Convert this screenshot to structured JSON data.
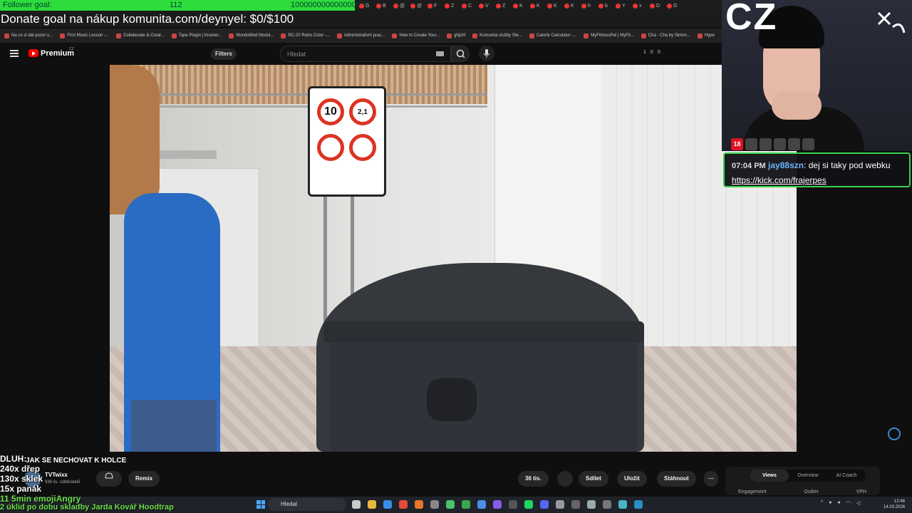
{
  "browser": {
    "follower_goal": {
      "label": "Follower goal:",
      "count": "112",
      "target": "100000000000000000",
      "progress": 0.0
    },
    "tabs": [
      "G",
      "B",
      "@",
      "@",
      "F",
      "Z",
      "C",
      "V",
      "Z",
      "K",
      "K",
      "K",
      "K",
      "h",
      "b",
      "Y",
      "x",
      "D",
      "G"
    ],
    "donate_text": "Donate goal na nákup komunita.com/deynyel: $0/$100",
    "bookmarks": [
      "Na co si dát pozor u...",
      "First Music Lesson -...",
      "Collaborate & Creat...",
      "Tape Plugin | Kramer...",
      "MondoMod Modul...",
      "RC-20 Retro Color -...",
      "Administrativní prac...",
      "How to Create Your...",
      "ghjshf",
      "Komunita služby Ste...",
      "Calorie Calculator -...",
      "MyFitnessPal | MyFit...",
      "Cha - Cha by Simon...",
      "Hype"
    ]
  },
  "youtube": {
    "logo_text": "Premium",
    "logo_region": "CZ",
    "filters_label": "Filters",
    "search_placeholder": "Hledat",
    "ext_counts": [
      "1",
      "0",
      "0"
    ]
  },
  "stream_overlay": {
    "cz_label": "CZ",
    "badges": [
      "18",
      "",
      "",
      "",
      "",
      ""
    ],
    "chat": {
      "time": "07:04 PM",
      "user": "jay88szn",
      "message": ": dej si taky pod webku ",
      "link": "https://kick.com/frajerpes"
    },
    "stats": {
      "title": "DLUH:",
      "line1": "240x dřep",
      "line2": "130x sklek",
      "line3": "15x panák",
      "line4": "11 5min emojiAngry"
    },
    "song": "2 úklid po dobu skladby Jarda Kovář Hoodtrap"
  },
  "video": {
    "sign_values": [
      "10",
      "2,1"
    ],
    "title": "JAK SE NECHOVAT K HOLCE",
    "channel": "TVTwixx",
    "subs": "936 tis. odběratelů",
    "remix_label": "Remix",
    "likes": "36 tis.",
    "share_label": "Sdílet",
    "save_label": "Uložit",
    "download_label": "Stáhnout"
  },
  "panel": {
    "tabs": [
      "Views",
      "Overview",
      "AI Coach"
    ],
    "sub": [
      "Engagement",
      "Outlier",
      "VPH"
    ]
  },
  "taskbar": {
    "search_label": "Hledat",
    "time": "12:46",
    "date": "14.03.2026"
  }
}
